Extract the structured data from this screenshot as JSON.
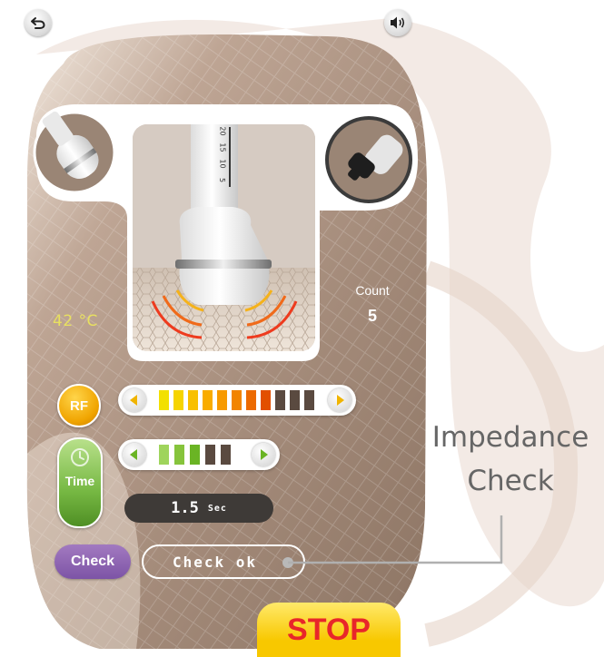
{
  "header": {
    "back_icon": "undo-arrow-icon",
    "sound_icon": "speaker-sound-icon"
  },
  "handpieces": {
    "left_thumb": "rf-handpiece-angled",
    "center_view": "rf-handpiece-on-skin",
    "right_thumb": "handpiece-black-tip",
    "scale_marks": [
      "20",
      "15",
      "10",
      "5"
    ]
  },
  "readouts": {
    "temperature": "42 °C",
    "count_label": "Count",
    "count_value": "5"
  },
  "rf": {
    "label": "RF",
    "level": 8,
    "max_level": 11,
    "segment_colors": [
      "#f2e000",
      "#f6d400",
      "#f8c000",
      "#f9ac00",
      "#f79a00",
      "#f28400",
      "#ec6a00",
      "#e24f00",
      "#5a4a40",
      "#5a4a40",
      "#5a4a40"
    ]
  },
  "time": {
    "label": "Time",
    "icon": "clock-icon",
    "level": 3,
    "max_level": 5,
    "segment_colors": [
      "#9fd45c",
      "#86c43c",
      "#6ab424",
      "#5a4a40",
      "#5a4a40"
    ],
    "display_value": "1.5",
    "display_unit": "Sec"
  },
  "check": {
    "button_label": "Check",
    "status_text": "Check ok"
  },
  "stop_label": "STOP",
  "annotation": {
    "line1": "Impedance",
    "line2": "Check"
  },
  "colors": {
    "panel_bronze": "#9e8574",
    "rf_badge": "#f0a400",
    "time_badge": "#76b843",
    "check_button": "#8a62b0",
    "stop_yellow": "#f8c800",
    "stop_text": "#e8262a",
    "temperature_text": "#e8e060"
  }
}
